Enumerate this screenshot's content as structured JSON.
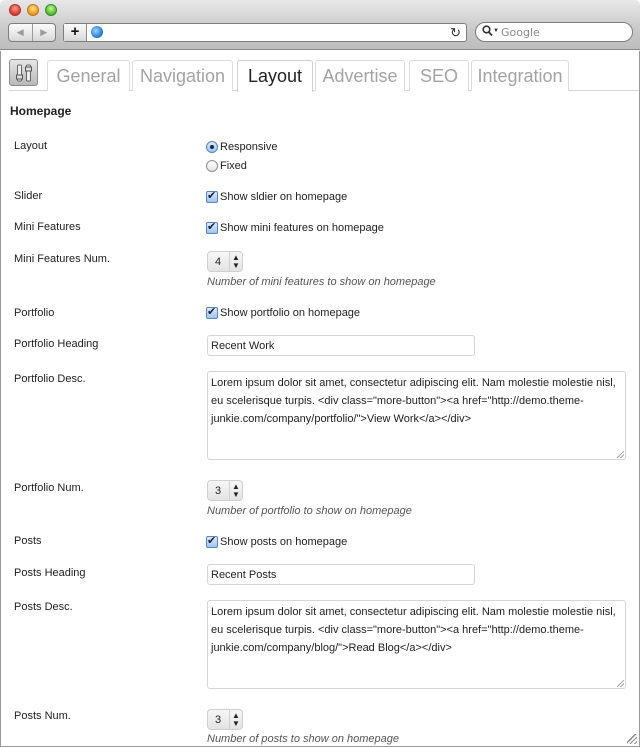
{
  "browser": {
    "back_icon": "◀",
    "forward_icon": "▶",
    "new_tab_icon": "+",
    "reload_icon": "↻",
    "url": "",
    "search_placeholder": "Google",
    "search_icon": "🔍"
  },
  "tabs": [
    {
      "label": "General",
      "active": false
    },
    {
      "label": "Navigation",
      "active": false
    },
    {
      "label": "Layout",
      "active": true
    },
    {
      "label": "Advertise",
      "active": false
    },
    {
      "label": "SEO",
      "active": false
    },
    {
      "label": "Integration",
      "active": false
    }
  ],
  "section": {
    "title": "Homepage"
  },
  "fields": {
    "layout": {
      "label": "Layout",
      "options": [
        "Responsive",
        "Fixed"
      ],
      "selected": "Responsive"
    },
    "slider": {
      "label": "Slider",
      "checkbox_label": "Show sldier on homepage",
      "checked": true
    },
    "mini_features": {
      "label": "Mini Features",
      "checkbox_label": "Show mini features on homepage",
      "checked": true
    },
    "mini_features_num": {
      "label": "Mini Features Num.",
      "value": "4",
      "hint": "Number of mini features to show on homepage"
    },
    "portfolio": {
      "label": "Portfolio",
      "checkbox_label": "Show portfolio on homepage",
      "checked": true
    },
    "portfolio_heading": {
      "label": "Portfolio Heading",
      "value": "Recent Work"
    },
    "portfolio_desc": {
      "label": "Portfolio Desc.",
      "value": "Lorem ipsum dolor sit amet, consectetur adipiscing elit. Nam molestie molestie nisl, eu scelerisque turpis. <div class=\"more-button\"><a href=\"http://demo.theme-junkie.com/company/portfolio/\">View Work</a></div>"
    },
    "portfolio_num": {
      "label": "Portfolio Num.",
      "value": "3",
      "hint": "Number of portfolio to show on homepage"
    },
    "posts": {
      "label": "Posts",
      "checkbox_label": "Show posts on homepage",
      "checked": true
    },
    "posts_heading": {
      "label": "Posts Heading",
      "value": "Recent Posts"
    },
    "posts_desc": {
      "label": "Posts Desc.",
      "value": "Lorem ipsum dolor sit amet, consectetur adipiscing elit. Nam molestie molestie nisl, eu scelerisque turpis. <div class=\"more-button\"><a href=\"http://demo.theme-junkie.com/company/blog/\">Read Blog</a></div>"
    },
    "posts_num": {
      "label": "Posts Num.",
      "value": "3",
      "hint": "Number of posts to show on homepage"
    }
  },
  "select_arrows": "▲▼"
}
